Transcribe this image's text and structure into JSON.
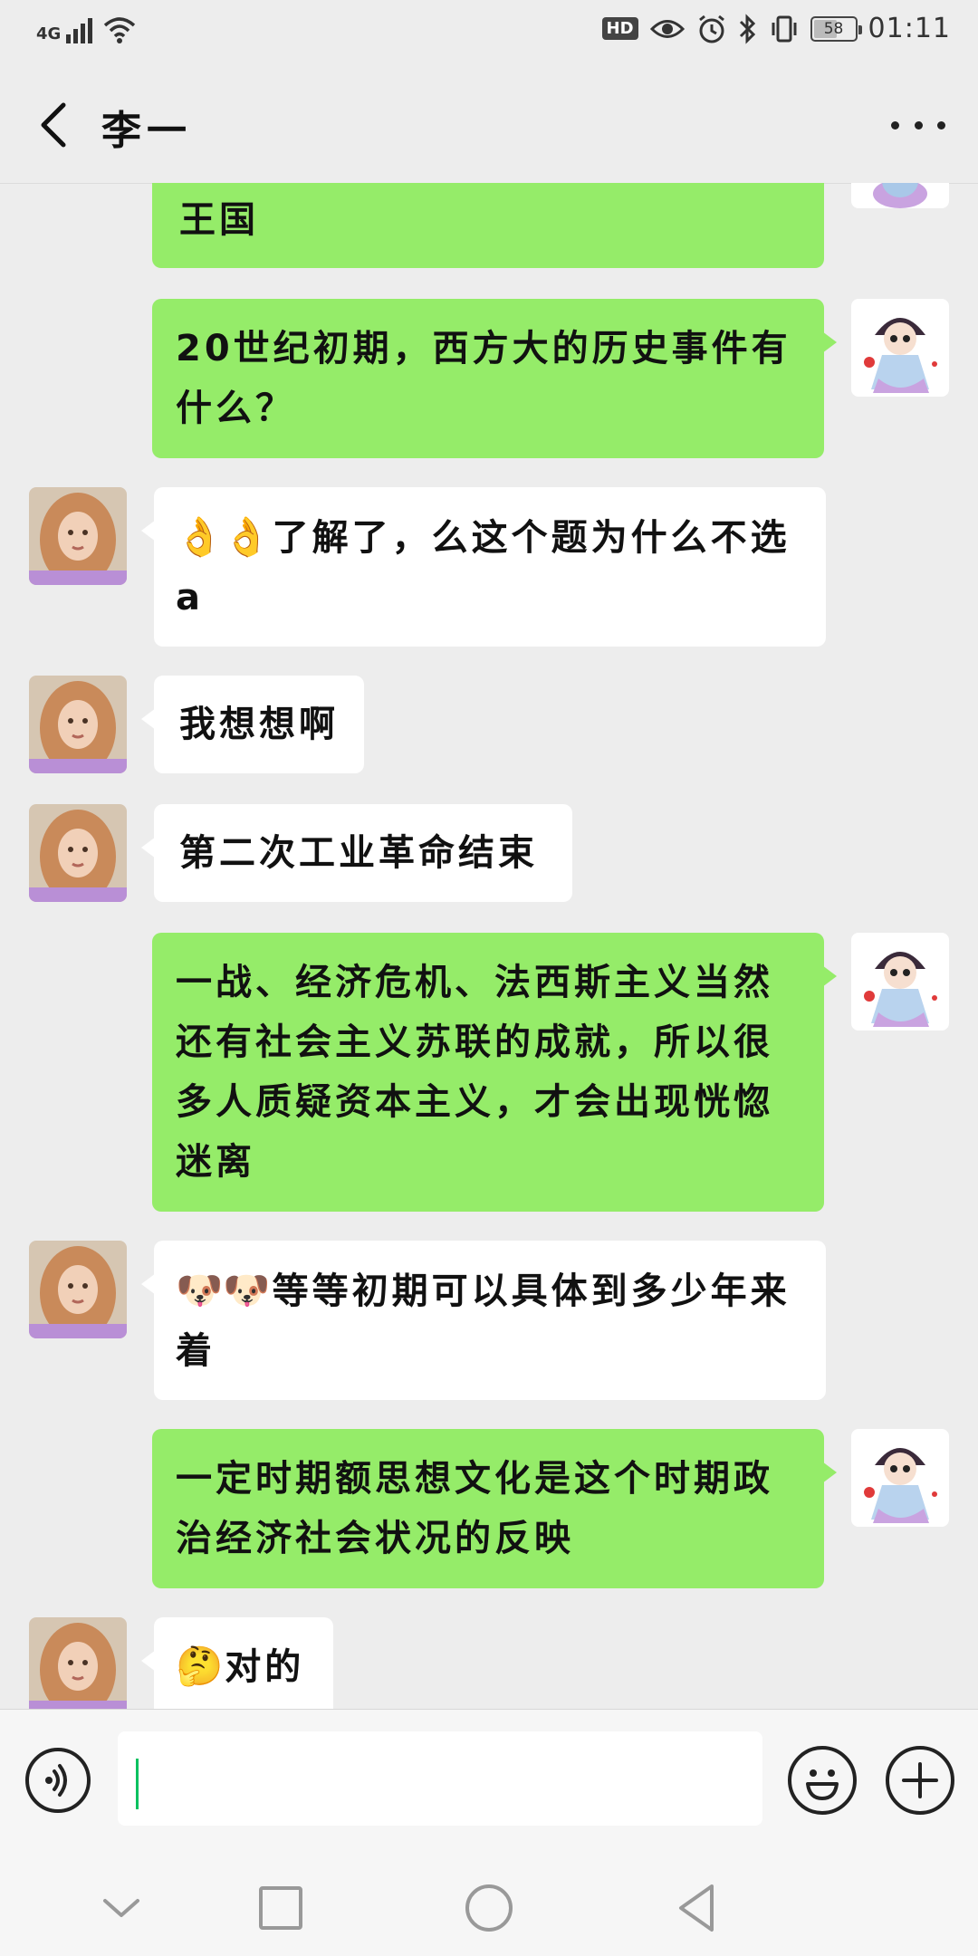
{
  "status_bar": {
    "network": "4G",
    "battery": "58",
    "battery_level": 0.58,
    "time": "01:11",
    "hd_label": "HD",
    "icons": [
      "signal-icon",
      "wifi-icon",
      "eye-icon",
      "alarm-icon",
      "bluetooth-icon",
      "vibrate-icon",
      "battery-icon"
    ]
  },
  "header": {
    "title": "李一",
    "back_icon": "chevron-left-icon",
    "more_icon": "more-icon"
  },
  "messages": [
    {
      "side": "me",
      "text": "王国"
    },
    {
      "side": "me",
      "text": "20世纪初期，西方大的历史事件有什么？"
    },
    {
      "side": "them",
      "emoji": "👌👌",
      "text": "了解了，么这个题为什么不选a"
    },
    {
      "side": "them",
      "text": "我想想啊"
    },
    {
      "side": "them",
      "text": "第二次工业革命结束"
    },
    {
      "side": "me",
      "text": "一战、经济危机、法西斯主义当然还有社会主义苏联的成就，所以很多人质疑资本主义，才会出现恍惚迷离"
    },
    {
      "side": "them",
      "emoji": "🐶🐶",
      "text": "等等初期可以具体到多少年来着"
    },
    {
      "side": "me",
      "text": "一定时期额思想文化是这个时期政治经济社会状况的反映"
    },
    {
      "side": "them",
      "emoji": "🤔",
      "text": "对的"
    }
  ],
  "input_bar": {
    "voice_icon": "voice-icon",
    "text_value": "",
    "emoji_icon": "emoji-icon",
    "plus_icon": "plus-icon"
  },
  "nav_bar": {
    "icons": [
      "nav-down-icon",
      "nav-recents-icon",
      "nav-home-icon",
      "nav-back-icon"
    ]
  },
  "colors": {
    "background": "#ededed",
    "my_bubble": "#95ec69",
    "their_bubble": "#ffffff",
    "caret": "#07c160"
  }
}
